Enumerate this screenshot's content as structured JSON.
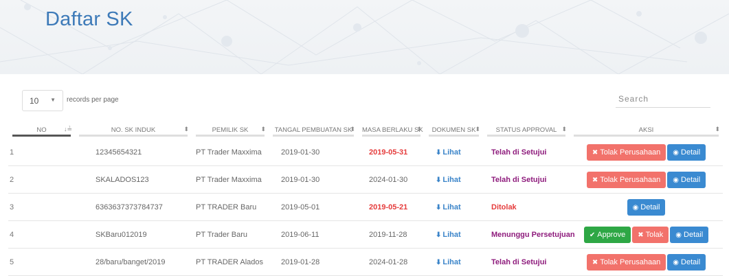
{
  "page": {
    "title": "Daftar SK"
  },
  "controls": {
    "page_length": "10",
    "page_length_label": "records per page",
    "search_placeholder": "Search"
  },
  "table": {
    "headers": [
      "NO",
      "NO. SK INDUK",
      "PEMILIK SK",
      "TANGAL PEMBUATAN SK",
      "MASA BERLAKU SK",
      "DOKUMEN SK",
      "STATUS APPROVAL",
      "AKSI"
    ],
    "rows": [
      {
        "no": "1",
        "sk_induk": "12345654321",
        "pemilik": "PT Trader Maxxima",
        "tanggal": "2019-01-30",
        "masa": "2019-05-31",
        "masa_expired": true,
        "dokumen": "Lihat",
        "status": "Telah di Setujui",
        "status_color": "#8e1b7c",
        "actions": [
          "Tolak Perusahaan",
          "Detail"
        ]
      },
      {
        "no": "2",
        "sk_induk": "SKALADOS123",
        "pemilik": "PT Trader Maxxima",
        "tanggal": "2019-01-30",
        "masa": "2024-01-30",
        "masa_expired": false,
        "dokumen": "Lihat",
        "status": "Telah di Setujui",
        "status_color": "#8e1b7c",
        "actions": [
          "Tolak Perusahaan",
          "Detail"
        ]
      },
      {
        "no": "3",
        "sk_induk": "6363637373784737",
        "pemilik": "PT TRADER Baru",
        "tanggal": "2019-05-01",
        "masa": "2019-05-21",
        "masa_expired": true,
        "dokumen": "Lihat",
        "status": "Ditolak",
        "status_color": "#e53b3b",
        "actions": [
          "Detail"
        ]
      },
      {
        "no": "4",
        "sk_induk": "SKBaru012019",
        "pemilik": "PT Trader Baru",
        "tanggal": "2019-06-11",
        "masa": "2019-11-28",
        "masa_expired": false,
        "dokumen": "Lihat",
        "status": "Menunggu Persetujuan",
        "status_color": "#8e1b7c",
        "actions": [
          "Approve",
          "Tolak",
          "Detail"
        ]
      },
      {
        "no": "5",
        "sk_induk": "28/baru/banget/2019",
        "pemilik": "PT TRADER Alados",
        "tanggal": "2019-01-28",
        "masa": "2024-01-28",
        "masa_expired": false,
        "dokumen": "Lihat",
        "status": "Telah di Setujui",
        "status_color": "#8e1b7c",
        "actions": [
          "Tolak Perusahaan",
          "Detail"
        ]
      }
    ]
  },
  "icons": {
    "download": "download-icon",
    "close": "close-icon",
    "eye": "eye-icon",
    "check": "check-icon",
    "sort": "sort-icon",
    "caret": "caret-down-icon"
  },
  "colors": {
    "title": "#3d7ab8",
    "danger": "#f2726b",
    "primary": "#3a8ad1",
    "success": "#2ea745",
    "expired": "#e53b3b"
  }
}
